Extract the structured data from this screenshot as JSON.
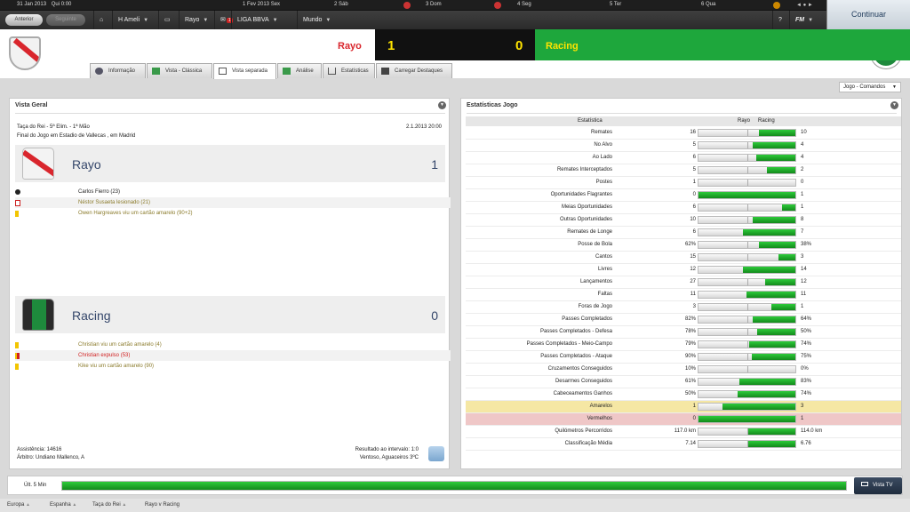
{
  "topbar": {
    "dates": [
      {
        "day": "31 Jan 2013",
        "label": "Qui 0:00"
      },
      {
        "day": "1 Fev 2013",
        "label": "Sex"
      },
      {
        "day": "2",
        "label": "Sáb"
      },
      {
        "day": "3",
        "label": "Dom"
      },
      {
        "day": "4",
        "label": "Seg"
      },
      {
        "day": "5",
        "label": "Ter"
      },
      {
        "day": "6",
        "label": "Qua"
      }
    ],
    "back_label": "Anterior",
    "forward_label": "Seguinte",
    "nav": {
      "manager": "H Ameli",
      "club": "Rayo",
      "league": "LIGA BBVA",
      "world": "Mundo",
      "fm": "FM"
    },
    "notifications": "1",
    "continue_label": "Continuar"
  },
  "match": {
    "home_team": "Rayo",
    "away_team": "Racing",
    "home_score": "1",
    "away_score": "0",
    "home_color": "#d9262d",
    "away_color": "#1ea73c"
  },
  "tabs": [
    {
      "label": "Informação",
      "icon": "info-icon"
    },
    {
      "label": "Vista - Clássica",
      "icon": "pitch-icon"
    },
    {
      "label": "Vista separada",
      "icon": "split-icon"
    },
    {
      "label": "Análise",
      "icon": "analysis-icon"
    },
    {
      "label": "Estatísticas",
      "icon": "stats-icon"
    },
    {
      "label": "Carregar Destaques",
      "icon": "camera-icon"
    }
  ],
  "view_selector": "Jogo - Comandos",
  "overview": {
    "title": "Vista Geral",
    "competition": "Taça do Rei - 5ª Elim. - 1ª Mão",
    "date": "2.1.2013 20:00",
    "venue": "Final do Jogo em Estadio de Vallecas , em Madrid",
    "home": {
      "name": "Rayo",
      "score": "1",
      "events": [
        {
          "icon": "goal-icon",
          "text": "Carlos Fierro (23)",
          "color": "#222"
        },
        {
          "icon": "injury-icon",
          "text": "Néstor Susaeta lesionado (21)",
          "color": "#8a7a2a"
        },
        {
          "icon": "yellow-card-icon",
          "text": "Owen Hargreaves viu um cartão amarelo (90+2)",
          "color": "#8a7a2a"
        }
      ]
    },
    "away": {
      "name": "Racing",
      "score": "0",
      "events": [
        {
          "icon": "yellow-card-icon",
          "text": "Christian viu um cartão amarelo (4)",
          "color": "#8a7a2a"
        },
        {
          "icon": "red-card-icon",
          "text": "Christian expulso (53)",
          "color": "#d02020"
        },
        {
          "icon": "yellow-card-icon",
          "text": "Kike viu um cartão amarelo (90)",
          "color": "#8a7a2a"
        }
      ]
    },
    "attendance": "Assistência: 14616",
    "referee": "Árbitro: Undiano Mallenco, A",
    "halftime": "Resultado ao intervalo: 1:0",
    "weather": "Ventoso, Aguaceiros 3ºC"
  },
  "stats": {
    "title": "Estatísticas Jogo",
    "header": {
      "label": "Estatística",
      "home": "Rayo",
      "away": "Racing"
    },
    "rows": [
      {
        "label": "Remates",
        "home": "16",
        "away": "10",
        "share": 0.38
      },
      {
        "label": "No Alvo",
        "home": "5",
        "away": "4",
        "share": 0.44
      },
      {
        "label": "Ao Lado",
        "home": "6",
        "away": "4",
        "share": 0.4
      },
      {
        "label": "Remates Interceptados",
        "home": "5",
        "away": "2",
        "share": 0.29
      },
      {
        "label": "Postes",
        "home": "1",
        "away": "0",
        "share": 0
      },
      {
        "label": "Oportunidades Flagrantes",
        "home": "0",
        "away": "1",
        "share": 1
      },
      {
        "label": "Meias Oportunidades",
        "home": "6",
        "away": "1",
        "share": 0.14
      },
      {
        "label": "Outras Oportunidades",
        "home": "10",
        "away": "8",
        "share": 0.44
      },
      {
        "label": "Remates de Longe",
        "home": "6",
        "away": "7",
        "share": 0.54
      },
      {
        "label": "Posse de Bola",
        "home": "62%",
        "away": "38%",
        "share": 0.38
      },
      {
        "label": "Cantos",
        "home": "15",
        "away": "3",
        "share": 0.17
      },
      {
        "label": "Livres",
        "home": "12",
        "away": "14",
        "share": 0.54
      },
      {
        "label": "Lançamentos",
        "home": "27",
        "away": "12",
        "share": 0.31
      },
      {
        "label": "Faltas",
        "home": "11",
        "away": "11",
        "share": 0.5
      },
      {
        "label": "Foras de Jogo",
        "home": "3",
        "away": "1",
        "share": 0.25
      },
      {
        "label": "Passes Completados",
        "home": "82%",
        "away": "64%",
        "share": 0.44
      },
      {
        "label": "Passes Completados - Defesa",
        "home": "78%",
        "away": "50%",
        "share": 0.39
      },
      {
        "label": "Passes Completados - Meio-Campo",
        "home": "79%",
        "away": "74%",
        "share": 0.48
      },
      {
        "label": "Passes Completados - Ataque",
        "home": "90%",
        "away": "75%",
        "share": 0.45
      },
      {
        "label": "Cruzamentos Conseguidos",
        "home": "10%",
        "away": "0%",
        "share": 0
      },
      {
        "label": "Desarmes Conseguidos",
        "home": "61%",
        "away": "83%",
        "share": 0.58
      },
      {
        "label": "Cabeceamentos Ganhos",
        "home": "50%",
        "away": "74%",
        "share": 0.6
      },
      {
        "label": "Amarelos",
        "home": "1",
        "away": "3",
        "share": 0.75,
        "highlight": "amarelos"
      },
      {
        "label": "Vermelhos",
        "home": "0",
        "away": "1",
        "share": 1,
        "highlight": "vermelhos"
      },
      {
        "label": "Quilómetros Percorridos",
        "home": "117.0 km",
        "away": "114.0 km",
        "share": 0.49
      },
      {
        "label": "Classificação Média",
        "home": "7.14",
        "away": "6.76",
        "share": 0.49
      }
    ]
  },
  "timeline": {
    "label": "Últ. 5 Min",
    "progress": 1.0,
    "tv_label": "Vista TV"
  },
  "footer": {
    "crumbs": [
      "Europa",
      "Espanha",
      "Taça do Rei",
      "Rayo v Racing"
    ]
  }
}
